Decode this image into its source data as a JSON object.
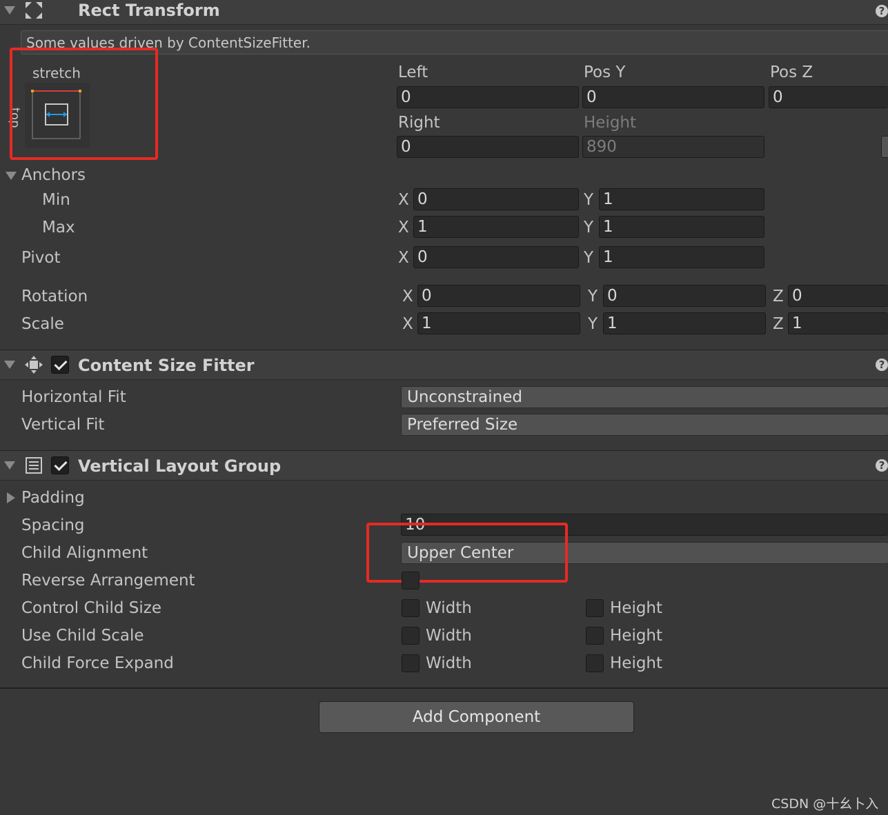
{
  "rect_transform": {
    "title": "Rect Transform",
    "notice": "Some values driven by ContentSizeFitter.",
    "anchor_preset_label": "stretch",
    "anchor_preset_side_label": "top",
    "fields": {
      "left_label": "Left",
      "left_value": "0",
      "posy_label": "Pos Y",
      "posy_value": "0",
      "posz_label": "Pos Z",
      "posz_value": "0",
      "right_label": "Right",
      "right_value": "0",
      "height_label": "Height",
      "height_value": "890"
    },
    "anchors_label": "Anchors",
    "min_label": "Min",
    "min_x": "0",
    "min_y": "1",
    "max_label": "Max",
    "max_x": "1",
    "max_y": "1",
    "pivot_label": "Pivot",
    "pivot_x": "0",
    "pivot_y": "1",
    "rotation_label": "Rotation",
    "rot_x": "0",
    "rot_y": "0",
    "rot_z": "0",
    "scale_label": "Scale",
    "scale_x": "1",
    "scale_y": "1",
    "scale_z": "1",
    "axis_x": "X",
    "axis_y": "Y",
    "axis_z": "Z"
  },
  "content_size_fitter": {
    "title": "Content Size Fitter",
    "enabled": true,
    "horizontal_fit_label": "Horizontal Fit",
    "horizontal_fit_value": "Unconstrained",
    "vertical_fit_label": "Vertical Fit",
    "vertical_fit_value": "Preferred Size"
  },
  "vertical_layout_group": {
    "title": "Vertical Layout Group",
    "enabled": true,
    "padding_label": "Padding",
    "spacing_label": "Spacing",
    "spacing_value": "10",
    "child_alignment_label": "Child Alignment",
    "child_alignment_value": "Upper Center",
    "reverse_arrangement_label": "Reverse Arrangement",
    "control_child_size_label": "Control Child Size",
    "use_child_scale_label": "Use Child Scale",
    "child_force_expand_label": "Child Force Expand",
    "width_label": "Width",
    "height_label": "Height"
  },
  "add_component_label": "Add Component",
  "help_glyph": "?",
  "watermark": "CSDN @十幺卜入",
  "colors": {
    "highlight": "#e52b23",
    "anchor_blue": "#1e9be6",
    "anchor_red": "#d04040"
  }
}
